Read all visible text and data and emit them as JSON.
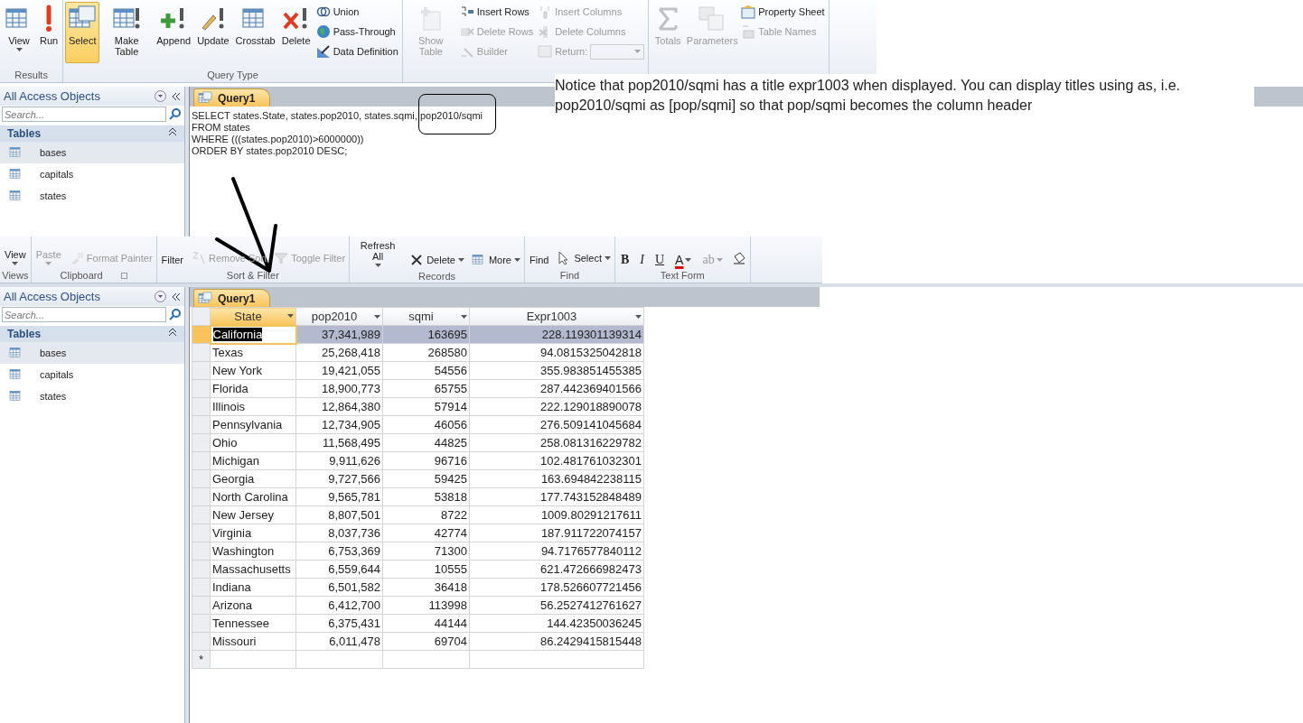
{
  "design_view": {
    "ribbon": {
      "groups": [
        {
          "label": "Results",
          "buttons": [
            {
              "kind": "large",
              "label": "View",
              "dropdown": true,
              "disabled": false
            },
            {
              "kind": "large",
              "label": "Run",
              "dropdown": false,
              "disabled": false
            }
          ]
        },
        {
          "label": "Query Type",
          "buttons": [
            {
              "kind": "large",
              "label": "Select",
              "disabled": false,
              "selected": true
            },
            {
              "kind": "large",
              "label": "Make Table",
              "disabled": false,
              "selected": false
            },
            {
              "kind": "large",
              "label": "Append",
              "disabled": false,
              "selected": false
            },
            {
              "kind": "large",
              "label": "Update",
              "disabled": false,
              "selected": false
            },
            {
              "kind": "large",
              "label": "Crosstab",
              "disabled": false,
              "selected": false
            },
            {
              "kind": "large",
              "label": "Delete",
              "disabled": false,
              "selected": false
            },
            {
              "kind": "small",
              "label": "Union",
              "disabled": false,
              "selected": false
            },
            {
              "kind": "small",
              "label": "Pass-Through",
              "disabled": false,
              "selected": false
            },
            {
              "kind": "small",
              "label": "Data Definition",
              "disabled": false,
              "selected": false
            }
          ]
        },
        {
          "buttons": [
            {
              "kind": "large",
              "label": "Show Table",
              "disabled": true
            },
            {
              "kind": "small",
              "label": "Insert Rows",
              "disabled": false
            },
            {
              "kind": "small",
              "label": "Delete Rows",
              "disabled": true
            },
            {
              "kind": "small",
              "label": "Builder",
              "disabled": true
            },
            {
              "kind": "small",
              "label": "Insert Columns",
              "disabled": true
            },
            {
              "kind": "small",
              "label": "Delete Columns",
              "disabled": true
            },
            {
              "kind": "combo",
              "label": "Return:",
              "dropdown": true,
              "disabled": true
            }
          ]
        },
        {
          "buttons": [
            {
              "kind": "large",
              "label": "Totals",
              "disabled": true
            },
            {
              "kind": "large",
              "label": "Parameters",
              "disabled": true
            },
            {
              "kind": "small",
              "label": "Property Sheet",
              "disabled": false
            },
            {
              "kind": "small",
              "label": "Table Names",
              "disabled": true
            }
          ]
        }
      ]
    },
    "nav": {
      "title": "All Access Objects",
      "search": {
        "placeholder": "Search..."
      },
      "section": "Tables",
      "items": [
        {
          "label": "bases",
          "selected": true
        },
        {
          "label": "capitals",
          "selected": false
        },
        {
          "label": "states",
          "selected": false
        }
      ]
    },
    "document": {
      "tab": "Query1",
      "sql": [
        "SELECT states.State, states.pop2010, states.sqmi, pop2010/sqmi",
        "FROM states",
        "WHERE (((states.pop2010)>6000000))",
        "ORDER BY states.pop2010 DESC;"
      ]
    }
  },
  "note": "Notice that pop2010/sqmi has a title expr1003 when displayed. You can display titles using as, i.e. pop2010/sqmi as [pop/sqmi] so that pop/sqmi becomes the column header",
  "datasheet_view": {
    "ribbon": {
      "groups": [
        {
          "label": "Views",
          "buttons": [
            {
              "kind": "large",
              "label": "View",
              "dropdown": true,
              "disabled": false
            }
          ]
        },
        {
          "label": "Clipboard",
          "launcher": true,
          "buttons": [
            {
              "kind": "large",
              "label": "Paste",
              "dropdown": true,
              "disabled": true
            },
            {
              "kind": "small",
              "label": "Format Painter",
              "dropdown": false,
              "disabled": true
            }
          ]
        },
        {
          "label": "Sort & Filter",
          "buttons": [
            {
              "kind": "large",
              "label": "Filter",
              "dropdown": false,
              "disabled": false
            },
            {
              "kind": "small",
              "label": "Remove Sort",
              "dropdown": false,
              "disabled": true
            },
            {
              "kind": "small",
              "label": "Toggle Filter",
              "dropdown": false,
              "disabled": true
            }
          ]
        },
        {
          "label": "Records",
          "buttons": [
            {
              "kind": "large",
              "label": "Refresh All",
              "dropdown": true,
              "disabled": false
            },
            {
              "kind": "small",
              "label": "Delete",
              "dropdown": true,
              "disabled": false
            },
            {
              "kind": "small",
              "label": "More",
              "dropdown": true,
              "disabled": false
            }
          ]
        },
        {
          "label": "Find",
          "buttons": [
            {
              "kind": "large",
              "label": "Find",
              "dropdown": false,
              "disabled": false
            },
            {
              "kind": "small",
              "label": "Select",
              "dropdown": true,
              "disabled": false
            }
          ]
        },
        {
          "label": "Text Form",
          "buttons": [
            {
              "kind": "glyph",
              "label": "B",
              "dropdown": false,
              "disabled": false
            },
            {
              "kind": "glyph",
              "label": "I",
              "dropdown": false,
              "disabled": false
            },
            {
              "kind": "glyph",
              "label": "U",
              "dropdown": false,
              "disabled": false
            },
            {
              "kind": "glyph",
              "label": "A",
              "dropdown": true,
              "disabled": false
            },
            {
              "kind": "glyph",
              "label": "ab",
              "dropdown": true,
              "disabled": true
            },
            {
              "kind": "small",
              "dropdown": false,
              "disabled": false
            }
          ]
        }
      ]
    },
    "nav": {
      "title": "All Access Objects",
      "search": {
        "placeholder": "Search..."
      },
      "section": "Tables",
      "items": [
        {
          "label": "bases",
          "selected": true
        },
        {
          "label": "capitals",
          "selected": false
        },
        {
          "label": "states",
          "selected": false
        }
      ]
    },
    "document": {
      "tab": "Query1",
      "columns": [
        "State",
        "pop2010",
        "sqmi",
        "Expr1003"
      ],
      "new_row_marker": "*",
      "rows": [
        {
          "cells": [
            "California",
            "37,341,989",
            "163695",
            "228.119301139314"
          ],
          "selected": true
        },
        {
          "cells": [
            "Texas",
            "25,268,418",
            "268580",
            "94.0815325042818"
          ],
          "selected": false
        },
        {
          "cells": [
            "New York",
            "19,421,055",
            "54556",
            "355.983851455385"
          ],
          "selected": false
        },
        {
          "cells": [
            "Florida",
            "18,900,773",
            "65755",
            "287.442369401566"
          ],
          "selected": false
        },
        {
          "cells": [
            "Illinois",
            "12,864,380",
            "57914",
            "222.129018890078"
          ],
          "selected": false
        },
        {
          "cells": [
            "Pennsylvania",
            "12,734,905",
            "46056",
            "276.509141045684"
          ],
          "selected": false
        },
        {
          "cells": [
            "Ohio",
            "11,568,495",
            "44825",
            "258.081316229782"
          ],
          "selected": false
        },
        {
          "cells": [
            "Michigan",
            "9,911,626",
            "96716",
            "102.481761032301"
          ],
          "selected": false
        },
        {
          "cells": [
            "Georgia",
            "9,727,566",
            "59425",
            "163.694842238115"
          ],
          "selected": false
        },
        {
          "cells": [
            "North Carolina",
            "9,565,781",
            "53818",
            "177.743152848489"
          ],
          "selected": false
        },
        {
          "cells": [
            "New Jersey",
            "8,807,501",
            "8722",
            "1009.80291217611"
          ],
          "selected": false
        },
        {
          "cells": [
            "Virginia",
            "8,037,736",
            "42774",
            "187.911722074157"
          ],
          "selected": false
        },
        {
          "cells": [
            "Washington",
            "6,753,369",
            "71300",
            "94.7176577840112"
          ],
          "selected": false
        },
        {
          "cells": [
            "Massachusetts",
            "6,559,644",
            "10555",
            "621.472666982473"
          ],
          "selected": false
        },
        {
          "cells": [
            "Indiana",
            "6,501,582",
            "36418",
            "178.526607721456"
          ],
          "selected": false
        },
        {
          "cells": [
            "Arizona",
            "6,412,700",
            "113998",
            "56.2527412761627"
          ],
          "selected": false
        },
        {
          "cells": [
            "Tennessee",
            "6,375,431",
            "44144",
            "144.42350036245"
          ],
          "selected": false
        },
        {
          "cells": [
            "Missouri",
            "6,011,478",
            "69704",
            "86.2429415815448"
          ],
          "selected": false
        }
      ]
    }
  }
}
